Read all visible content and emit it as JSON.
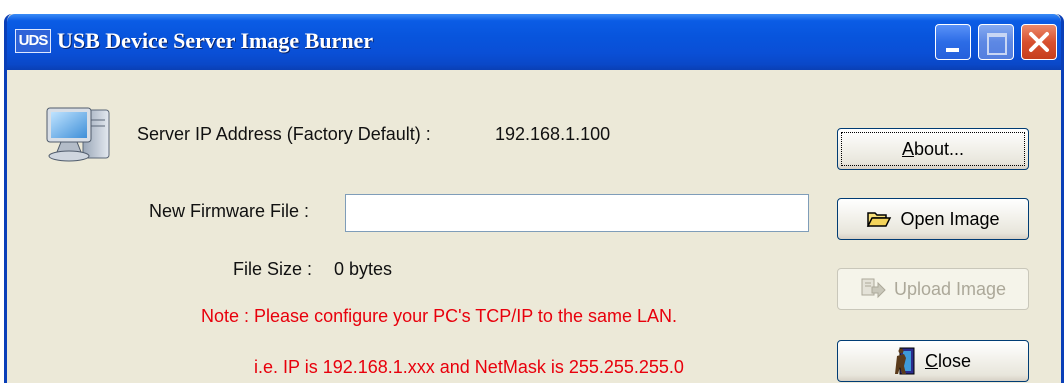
{
  "window": {
    "app_icon_text": "UDS",
    "title": "USB Device Server Image Burner"
  },
  "server": {
    "ip_label": "Server IP Address (Factory Default)  :",
    "ip_value": "192.168.1.100"
  },
  "firmware": {
    "label": "New Firmware File :",
    "value": "",
    "placeholder": ""
  },
  "file_size": {
    "label": "File Size :",
    "value": "0 bytes"
  },
  "notes": {
    "line1": "Note : Please configure your PC's TCP/IP to the same LAN.",
    "line2": "i.e. IP is 192.168.1.xxx and NetMask is 255.255.255.0",
    "color": "#e8000c"
  },
  "buttons": {
    "about": {
      "mnemonic": "A",
      "rest": "bout...",
      "enabled": true
    },
    "open_image": {
      "label": "Open Image",
      "icon": "folder-open-icon",
      "enabled": true
    },
    "upload_image": {
      "label": "Upload Image",
      "icon": "upload-icon",
      "enabled": false
    },
    "close": {
      "mnemonic": "C",
      "rest": "lose",
      "icon": "exit-door-icon",
      "enabled": true
    }
  },
  "colors": {
    "titlebar": "#0855dd",
    "client_background": "#ece9d8"
  }
}
